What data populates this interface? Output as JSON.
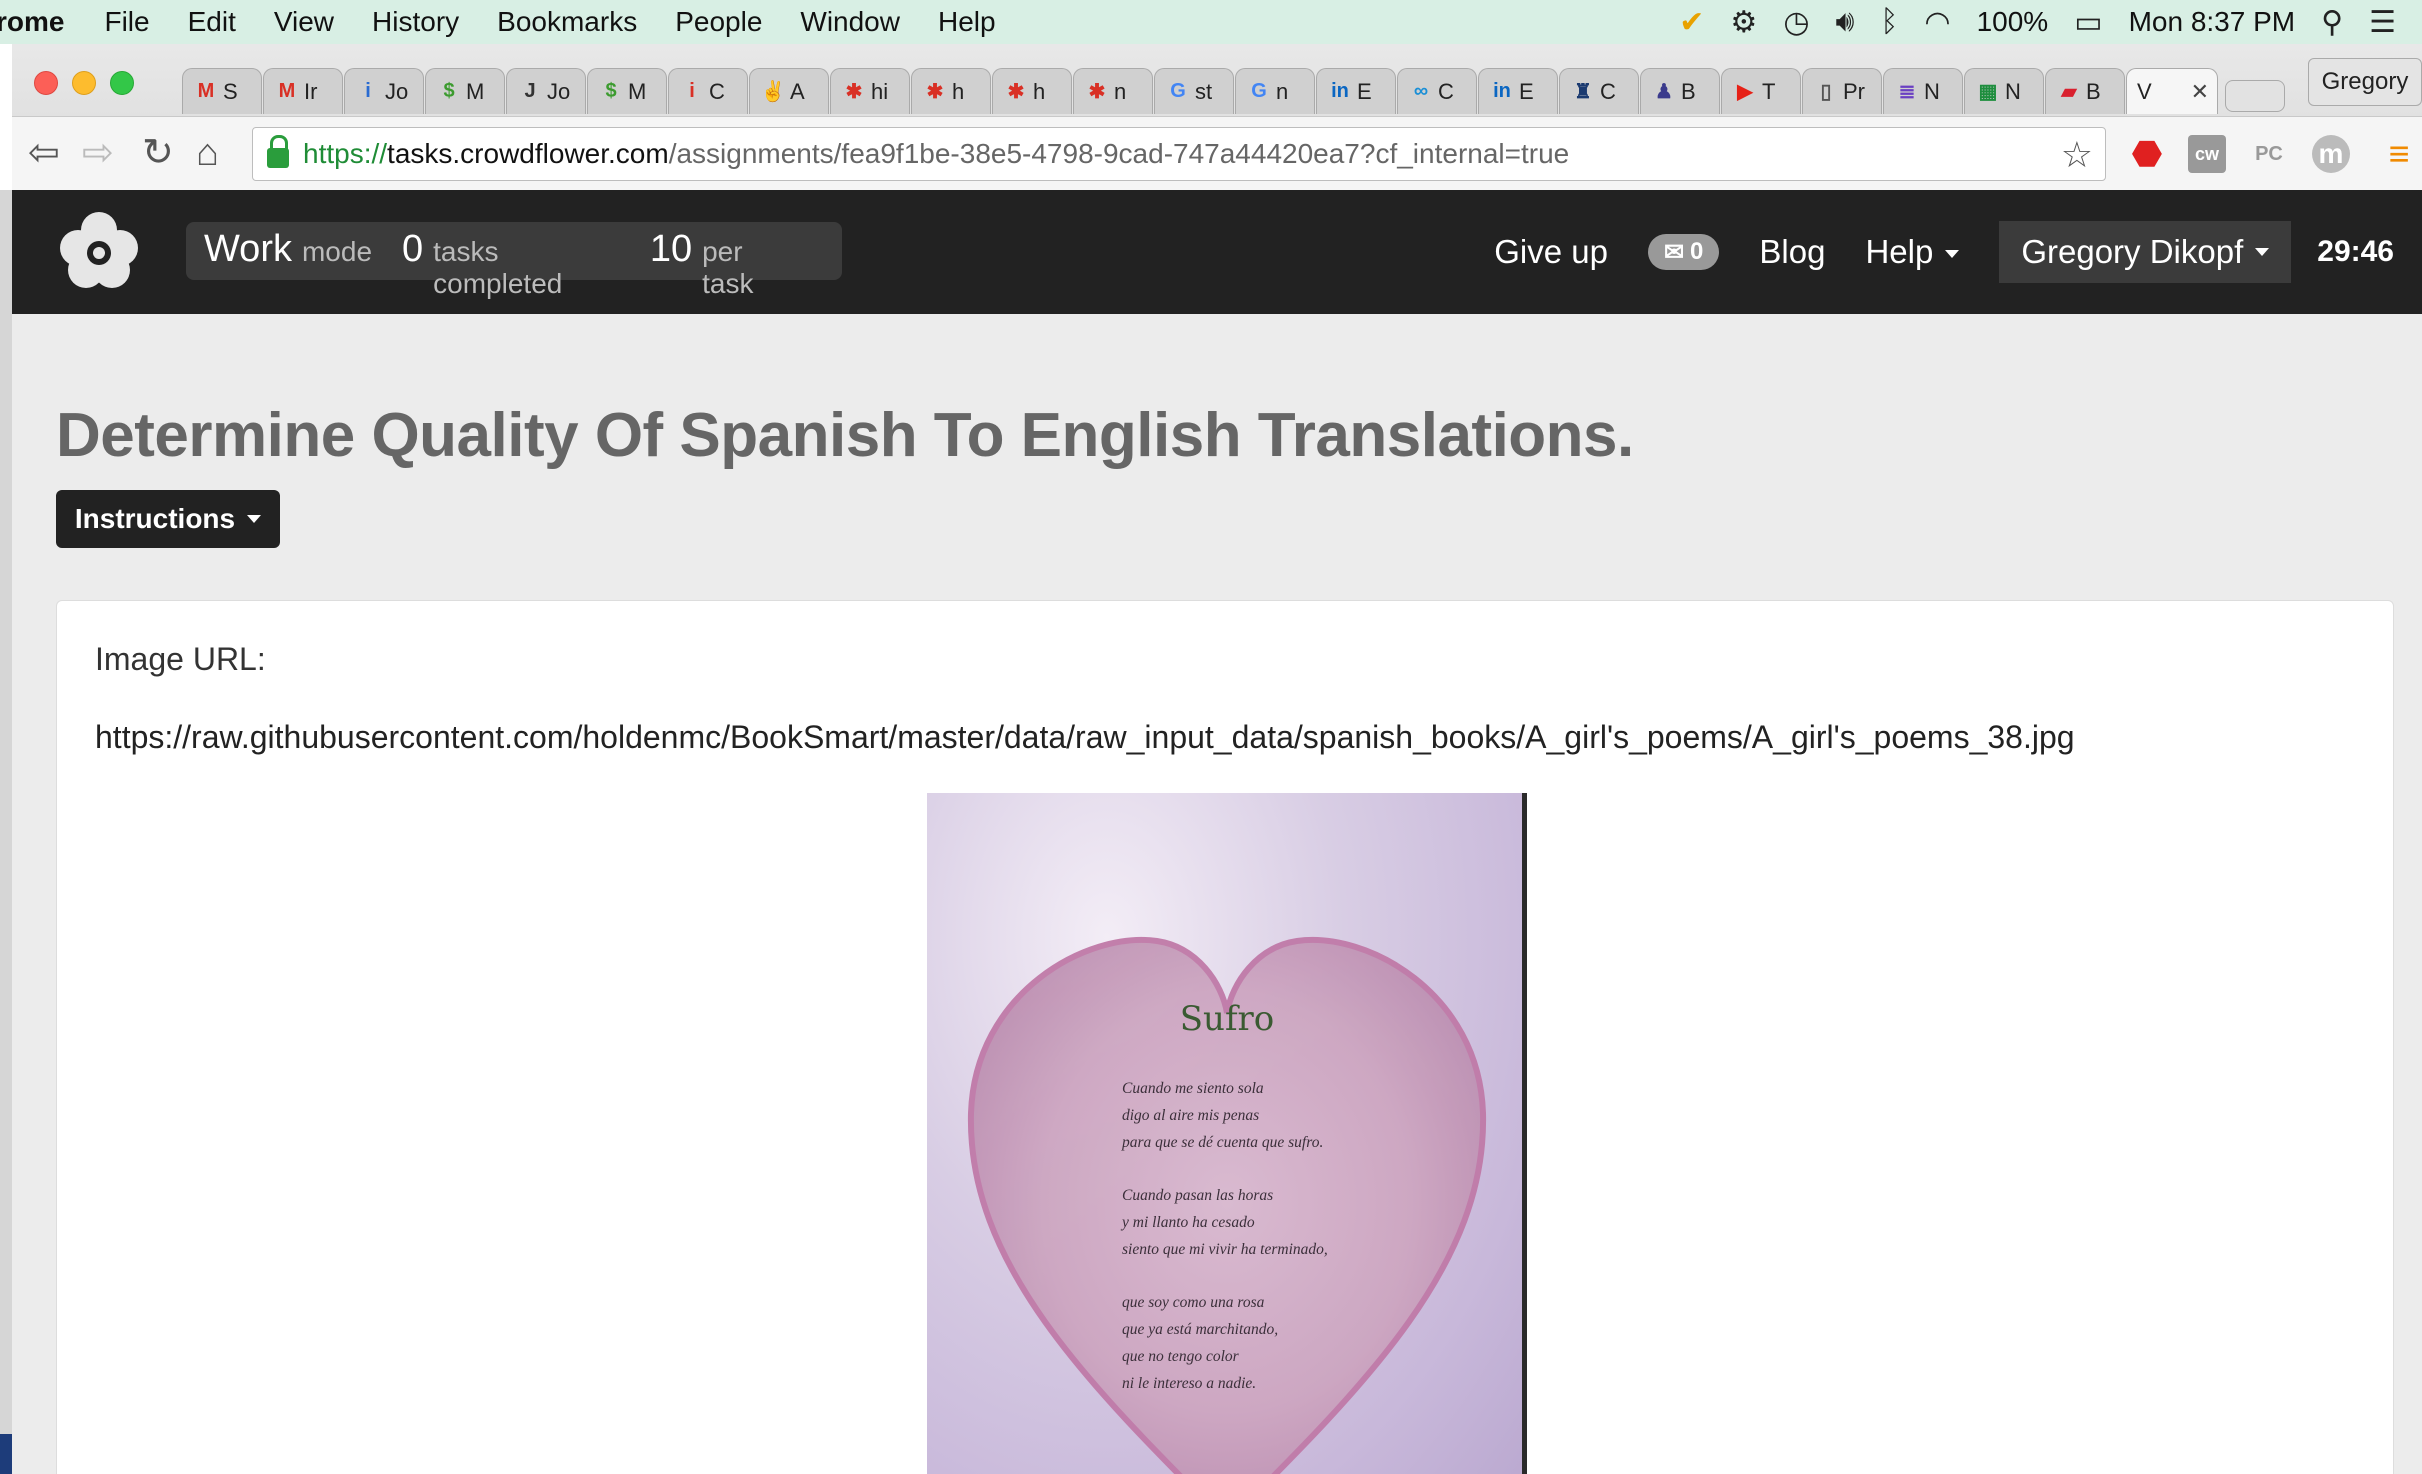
{
  "menubar": {
    "app": "rome",
    "items": [
      "File",
      "Edit",
      "View",
      "History",
      "Bookmarks",
      "People",
      "Window",
      "Help"
    ],
    "battery": "100%",
    "clock": "Mon 8:37 PM"
  },
  "browser": {
    "tabs": [
      {
        "fav": "M",
        "label": "S",
        "color": "#d93025"
      },
      {
        "fav": "M",
        "label": "Ir",
        "color": "#d93025"
      },
      {
        "fav": "i",
        "label": "Jo",
        "color": "#2a6bd1"
      },
      {
        "fav": "$",
        "label": "M",
        "color": "#3c9b2f"
      },
      {
        "fav": "J",
        "label": "Jo",
        "color": "#333333"
      },
      {
        "fav": "$",
        "label": "M",
        "color": "#3c9b2f"
      },
      {
        "fav": "i",
        "label": "C",
        "color": "#d93025"
      },
      {
        "fav": "✌",
        "label": "A",
        "color": "#333333"
      },
      {
        "fav": "✱",
        "label": "hi",
        "color": "#d93025"
      },
      {
        "fav": "✱",
        "label": "h",
        "color": "#d93025"
      },
      {
        "fav": "✱",
        "label": "h",
        "color": "#d93025"
      },
      {
        "fav": "✱",
        "label": "n",
        "color": "#d93025"
      },
      {
        "fav": "G",
        "label": "st",
        "color": "#4285f4"
      },
      {
        "fav": "G",
        "label": "n",
        "color": "#4285f4"
      },
      {
        "fav": "in",
        "label": "E",
        "color": "#0a66c2"
      },
      {
        "fav": "∞",
        "label": "C",
        "color": "#1a8fd6"
      },
      {
        "fav": "in",
        "label": "E",
        "color": "#0a66c2"
      },
      {
        "fav": "♜",
        "label": "C",
        "color": "#1b3a70"
      },
      {
        "fav": "♟",
        "label": "B",
        "color": "#3a3a8c"
      },
      {
        "fav": "▶",
        "label": "T",
        "color": "#e62117"
      },
      {
        "fav": "▯",
        "label": "Pr",
        "color": "#555555"
      },
      {
        "fav": "≣",
        "label": "N",
        "color": "#6a3fc2"
      },
      {
        "fav": "▦",
        "label": "N",
        "color": "#1e8e3e"
      },
      {
        "fav": "▰",
        "label": "B",
        "color": "#d9202e"
      }
    ],
    "active_tab": {
      "label": "V",
      "close": "✕"
    },
    "profile": "Gregory",
    "url": {
      "scheme": "https://",
      "host": "tasks.crowdflower.com",
      "path": "/assignments/fea9f1be-38e5-4798-9cad-747a44420ea7?cf_internal=true"
    }
  },
  "header": {
    "mode_value": "Work",
    "mode_label": "mode",
    "tasks_value": "0",
    "tasks_label": "tasks completed",
    "per_value": "10",
    "per_label": "per task",
    "give_up": "Give up",
    "mail_count": "0",
    "blog": "Blog",
    "help": "Help",
    "user": "Gregory Dikopf",
    "timer": "29:46"
  },
  "page": {
    "title": "Determine Quality Of Spanish To English Translations.",
    "instructions_label": "Instructions",
    "image_url_label": "Image URL:",
    "image_url": "https://raw.githubusercontent.com/holdenmc/BookSmart/master/data/raw_input_data/spanish_books/A_girl's_poems/A_girl's_poems_38.jpg"
  },
  "poem": {
    "title": "Sufro",
    "stanzas": [
      [
        "Cuando me siento sola",
        "digo al aire mis penas",
        "para que se dé cuenta que sufro."
      ],
      [
        "Cuando pasan las horas",
        "y mi llanto ha cesado",
        "siento que mi vivir ha terminado,"
      ],
      [
        "que soy como una rosa",
        "que ya está marchitando,",
        "que no tengo color",
        "ni le intereso a nadie."
      ]
    ]
  },
  "colors": {
    "header_bg": "#222222",
    "url_green": "#1f8c36",
    "page_bg": "#ececec",
    "title_grey": "#666666"
  }
}
